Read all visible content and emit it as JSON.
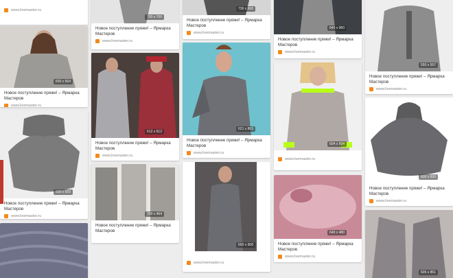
{
  "pins": [
    {
      "col": 0,
      "dim": "",
      "title": "",
      "src": "www.livemaster.ru",
      "bg": "#eeeeee"
    },
    {
      "col": 0,
      "dim": "600 x 564",
      "title": "Новое поступление пряжи! – Ярмарка Мастеров",
      "src": "www.livemaster.ru",
      "bg": "#b7b3ad"
    },
    {
      "col": 0,
      "dim": "600 x 600",
      "title": "Новое поступление пряжи! – Ярмарка Мастеров",
      "src": "www.livemaster.ru",
      "bg": "#e8e8e8"
    },
    {
      "col": 0,
      "dim": "",
      "title": "",
      "src": "",
      "bg": "#6e7188"
    },
    {
      "col": 1,
      "dim": "700 x 700",
      "title": "Новое поступление пряжи! – Ярмарка Мастеров",
      "src": "www.livemaster.ru",
      "bg": "#cfcfcf"
    },
    {
      "col": 1,
      "dim": "612 x 612",
      "title": "Новое поступление пряжи! – Ярмарка Мастеров",
      "src": "www.livemaster.ru",
      "bg": "#3c3e3a"
    },
    {
      "col": 1,
      "dim": "700 x 464",
      "title": "Новое поступление пряжи! – Ярмарка Мастеров",
      "src": "",
      "bg": "#c8c5c0"
    },
    {
      "col": 2,
      "dim": "736 x 908",
      "title": "Новое поступление пряжи! – Ярмарка Мастеров",
      "src": "www.livemaster.ru",
      "bg": "#9a9a9a"
    },
    {
      "col": 2,
      "dim": "621 x 863",
      "title": "Новое поступление пряжи! – Ярмарка Мастеров",
      "src": "www.livemaster.ru",
      "bg": "#74c0cc"
    },
    {
      "col": 2,
      "dim": "600 x 908",
      "title": "",
      "src": "www.livemaster.ru",
      "bg": "#4d4a4c"
    },
    {
      "col": 3,
      "dim": "640 x 960",
      "title": "Новое поступление пряжи! – Ярмарка Мастеров",
      "src": "www.livemaster.ru",
      "bg": "#3f4246"
    },
    {
      "col": 3,
      "dim": "604 x 604",
      "title": "",
      "src": "www.livemaster.ru",
      "bg": "#efefef"
    },
    {
      "col": 3,
      "dim": "640 x 480",
      "title": "Новое поступление пряжи! – Ярмарка Мастеров",
      "src": "www.livemaster.ru",
      "bg": "#d59aa7"
    },
    {
      "col": 4,
      "dim": "550 x 557",
      "title": "Новое поступление пряжи! – Ярмарка Мастеров",
      "src": "www.livemaster.ru",
      "bg": "#ebebeb"
    },
    {
      "col": 4,
      "dim": "600 x 600",
      "title": "Новое поступление пряжи! – Ярмарка Мастеров",
      "src": "www.livemaster.ru",
      "bg": "#ffffff"
    },
    {
      "col": 4,
      "dim": "605 x 851",
      "title": "",
      "src": "",
      "bg": "#8e8c8f"
    }
  ]
}
